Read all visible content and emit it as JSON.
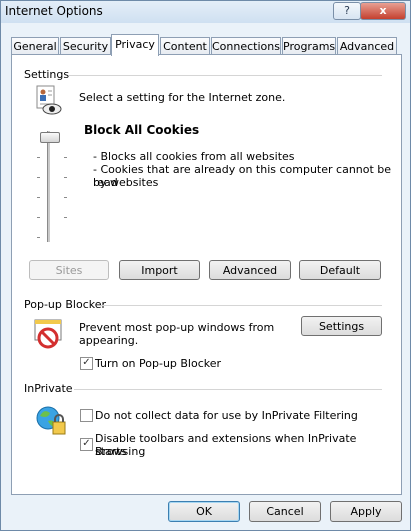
{
  "window": {
    "title": "Internet Options",
    "help_label": "?",
    "close_label": "x"
  },
  "tabs": [
    "General",
    "Security",
    "Privacy",
    "Content",
    "Connections",
    "Programs",
    "Advanced"
  ],
  "settings": {
    "heading": "Settings",
    "zone_prompt": "Select a setting for the Internet zone.",
    "level_title": "Block All Cookies",
    "description_lines": [
      "- Blocks all cookies from all websites",
      "- Cookies that are already on this computer cannot be read",
      "by websites"
    ],
    "buttons": {
      "sites": "Sites",
      "import": "Import",
      "advanced": "Advanced",
      "default": "Default"
    }
  },
  "popup_blocker": {
    "heading": "Pop-up Blocker",
    "description_lines": [
      "Prevent most pop-up windows from",
      "appearing."
    ],
    "settings_button": "Settings",
    "turn_on_label": "Turn on Pop-up Blocker",
    "turn_on_checked": true
  },
  "inprivate": {
    "heading": "InPrivate",
    "no_collect_label": "Do not collect data for use by InPrivate Filtering",
    "no_collect_checked": false,
    "disable_toolbars_lines": [
      "Disable toolbars and extensions when InPrivate Browsing",
      "starts"
    ],
    "disable_toolbars_checked": true
  },
  "footer": {
    "ok": "OK",
    "cancel": "Cancel",
    "apply": "Apply"
  }
}
